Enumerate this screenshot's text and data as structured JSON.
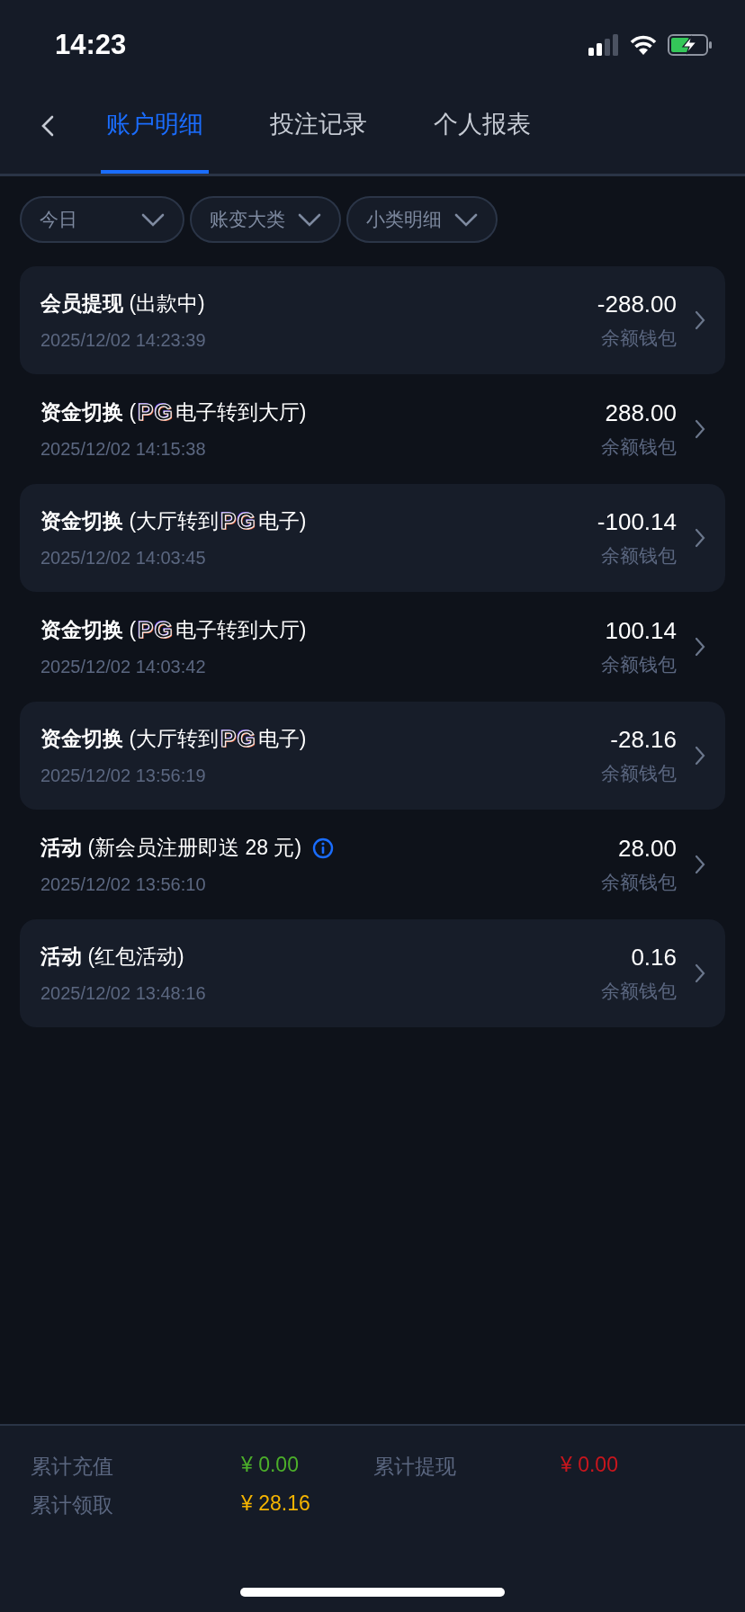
{
  "status_bar": {
    "time": "14:23"
  },
  "tabs": [
    {
      "label": "账户明细",
      "selected": true
    },
    {
      "label": "投注记录",
      "selected": false
    },
    {
      "label": "个人报表",
      "selected": false
    }
  ],
  "filters": [
    {
      "label": "今日"
    },
    {
      "label": "账变大类"
    },
    {
      "label": "小类明细"
    }
  ],
  "entries": [
    {
      "title": [
        {
          "kind": "text",
          "text": "**会员提现** (出款中)"
        }
      ],
      "info_icon": false,
      "time": "2025/12/02 14:23:39",
      "amount": "-288.00",
      "wallet": "余额钱包"
    },
    {
      "title": [
        {
          "kind": "text",
          "text": "**资金切换** ("
        },
        {
          "kind": "logo",
          "text": "PG"
        },
        {
          "kind": "text",
          "text": "电子转到大厅)"
        }
      ],
      "info_icon": false,
      "time": "2025/12/02 14:15:38",
      "amount": "288.00",
      "wallet": "余额钱包"
    },
    {
      "title": [
        {
          "kind": "text",
          "text": "**资金切换** (大厅转到"
        },
        {
          "kind": "logo",
          "text": "PG"
        },
        {
          "kind": "text",
          "text": "电子)"
        }
      ],
      "info_icon": false,
      "time": "2025/12/02 14:03:45",
      "amount": "-100.14",
      "wallet": "余额钱包"
    },
    {
      "title": [
        {
          "kind": "text",
          "text": "**资金切换** ("
        },
        {
          "kind": "logo",
          "text": "PG"
        },
        {
          "kind": "text",
          "text": "电子转到大厅)"
        }
      ],
      "info_icon": false,
      "time": "2025/12/02 14:03:42",
      "amount": "100.14",
      "wallet": "余额钱包"
    },
    {
      "title": [
        {
          "kind": "text",
          "text": "**资金切换** (大厅转到"
        },
        {
          "kind": "logo",
          "text": "PG"
        },
        {
          "kind": "text",
          "text": "电子)"
        }
      ],
      "info_icon": false,
      "time": "2025/12/02 13:56:19",
      "amount": "-28.16",
      "wallet": "余额钱包"
    },
    {
      "title": [
        {
          "kind": "text",
          "text": "**活动** (新会员注册即送 28 元)"
        }
      ],
      "info_icon": true,
      "time": "2025/12/02 13:56:10",
      "amount": "28.00",
      "wallet": "余额钱包"
    },
    {
      "title": [
        {
          "kind": "text",
          "text": "**活动** (红包活动)"
        }
      ],
      "info_icon": false,
      "time": "2025/12/02 13:48:16",
      "amount": "0.16",
      "wallet": "余额钱包"
    }
  ],
  "summary": [
    {
      "label": "累计充值",
      "value": "¥ 0.00",
      "color": "#4caf2a"
    },
    {
      "label": "累计提现",
      "value": "¥ 0.00",
      "color": "#c8161d"
    },
    {
      "label": "累计领取",
      "value": "¥ 28.16",
      "color": "#f5b400"
    }
  ]
}
